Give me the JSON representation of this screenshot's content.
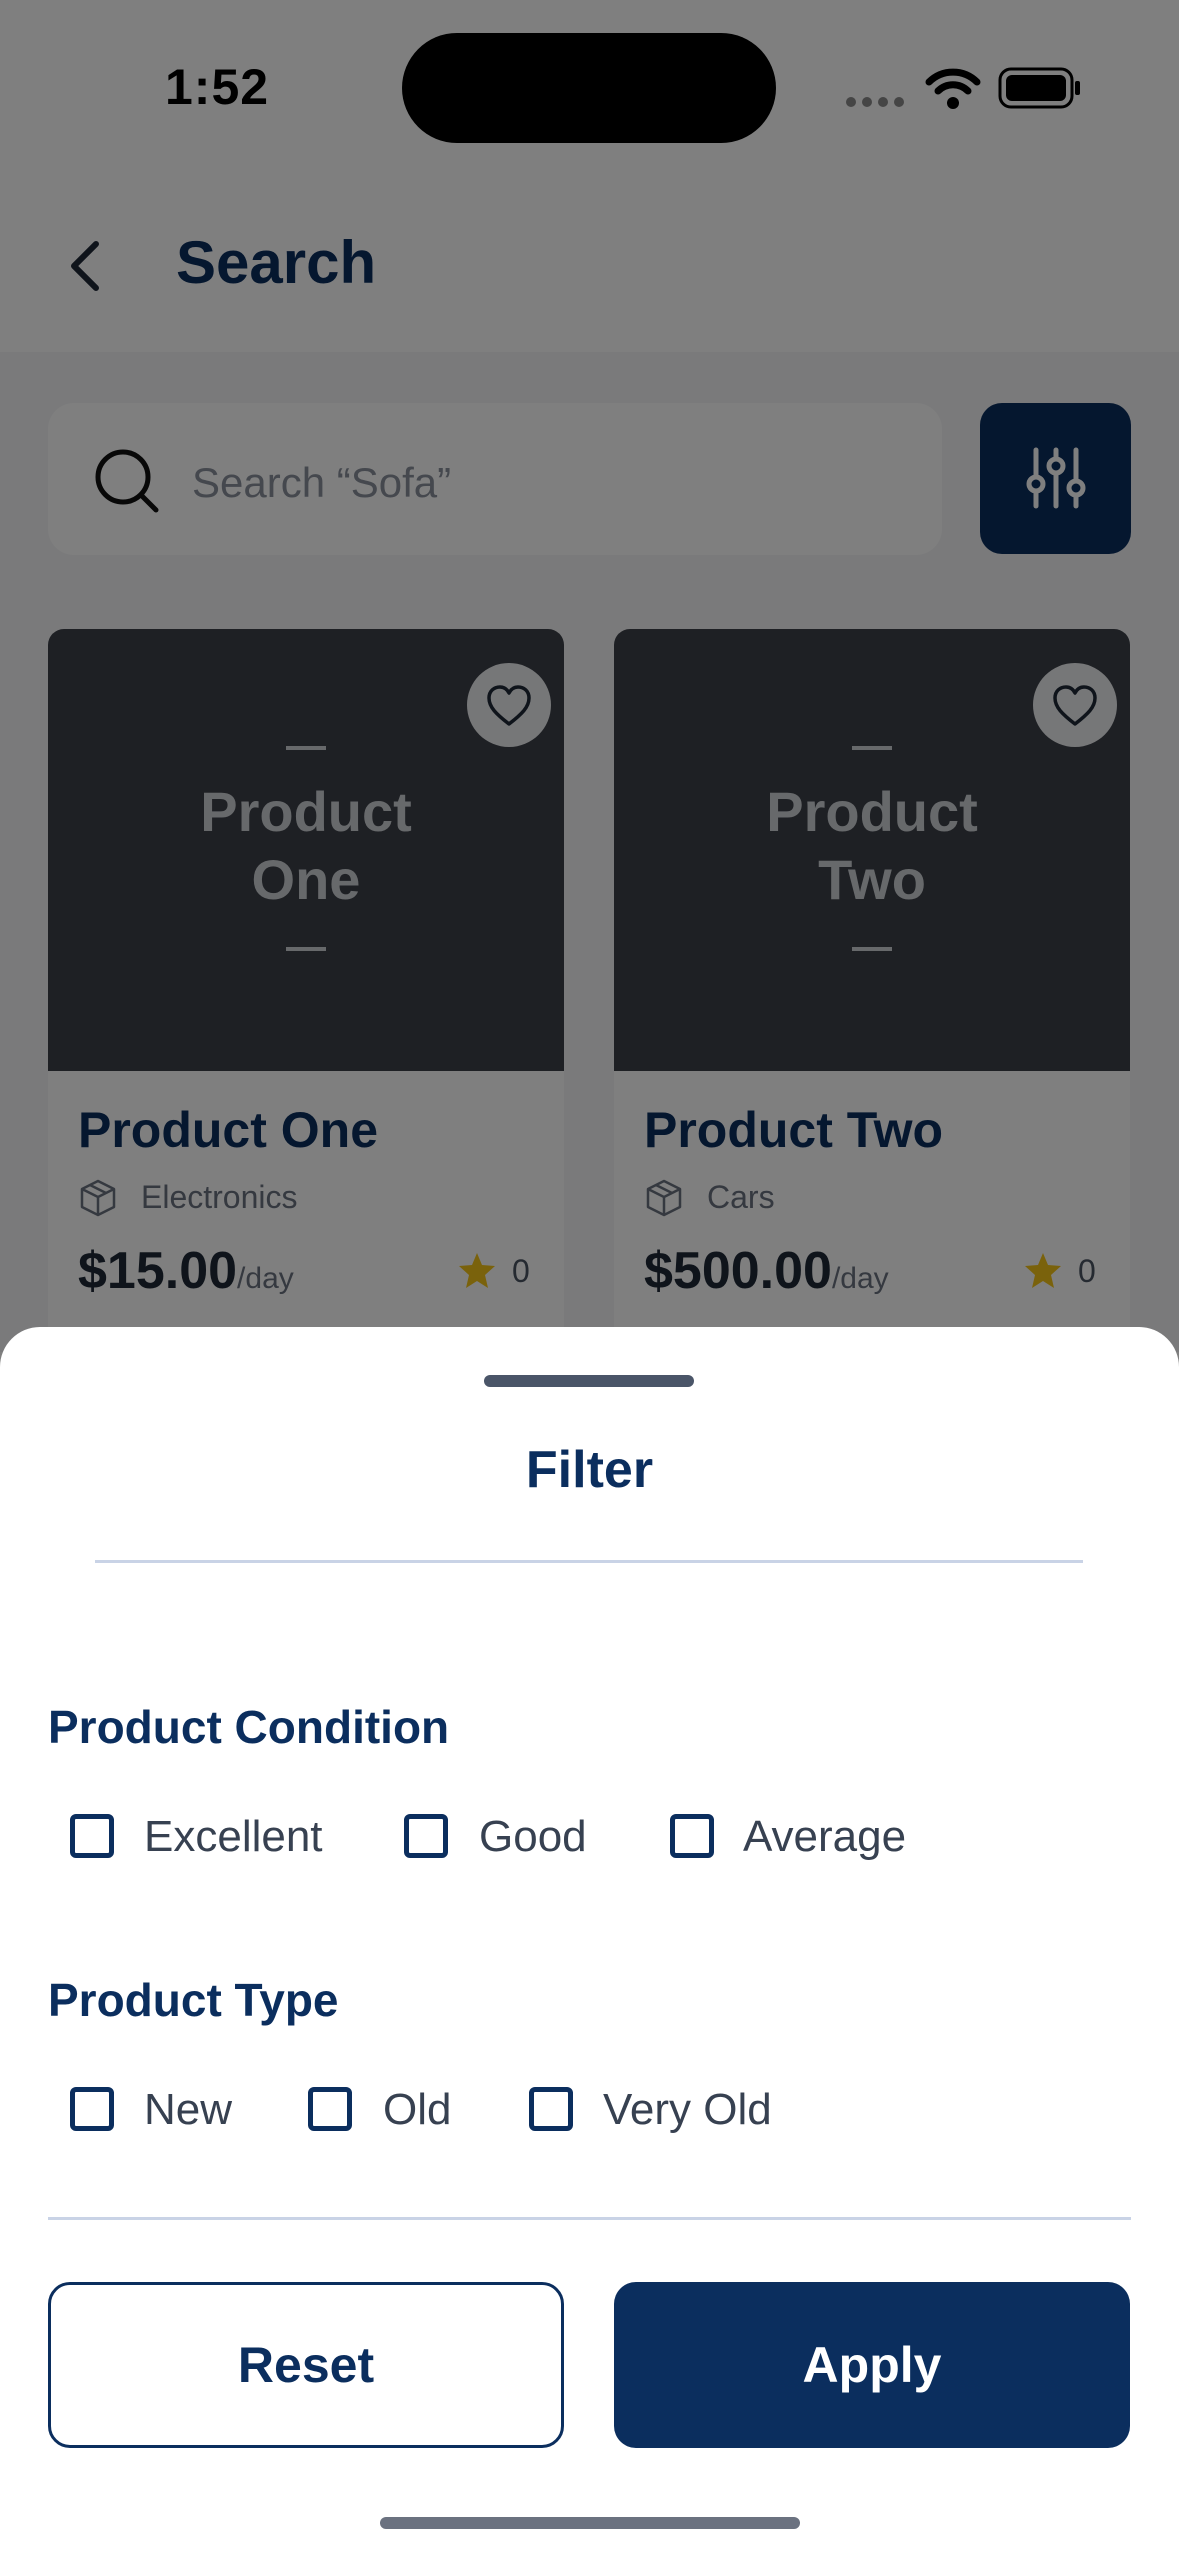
{
  "status_bar": {
    "time": "1:52"
  },
  "header": {
    "title": "Search"
  },
  "search": {
    "placeholder": "Search “Sofa”"
  },
  "products": [
    {
      "placeholder_line1": "Product",
      "placeholder_line2": "One",
      "name": "Product One",
      "category": "Electronics",
      "price": "$15.00",
      "price_unit": "/day",
      "rating": "0"
    },
    {
      "placeholder_line1": "Product",
      "placeholder_line2": "Two",
      "name": "Product Two",
      "category": "Cars",
      "price": "$500.00",
      "price_unit": "/day",
      "rating": "0"
    }
  ],
  "filter_sheet": {
    "title": "Filter",
    "condition": {
      "title": "Product Condition",
      "options": [
        "Excellent",
        "Good",
        "Average"
      ]
    },
    "type": {
      "title": "Product Type",
      "options": [
        "New",
        "Old",
        "Very Old"
      ]
    },
    "reset_label": "Reset",
    "apply_label": "Apply"
  },
  "colors": {
    "brand": "#0b2e5e",
    "star": "#f5c518"
  }
}
